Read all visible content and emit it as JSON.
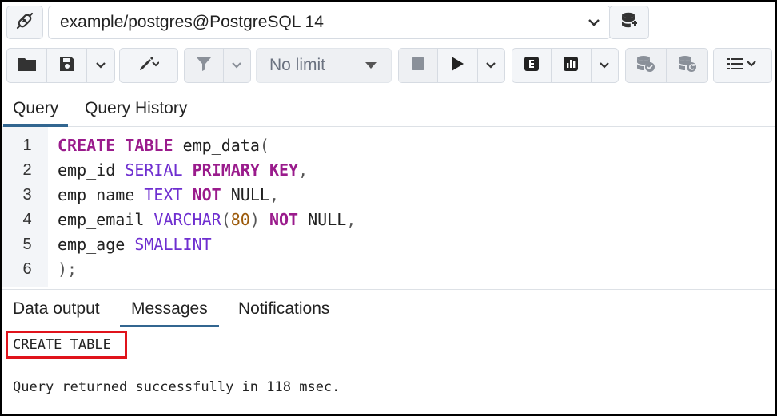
{
  "connection": {
    "label": "example/postgres@PostgreSQL 14"
  },
  "toolbar": {
    "limit_label": "No limit"
  },
  "tabs": [
    {
      "label": "Query"
    },
    {
      "label": "Query History"
    }
  ],
  "editor": {
    "lines": [
      {
        "num": "1"
      },
      {
        "num": "2"
      },
      {
        "num": "3"
      },
      {
        "num": "4"
      },
      {
        "num": "5"
      },
      {
        "num": "6"
      }
    ]
  },
  "code": {
    "l1": [
      "CREATE",
      "TABLE",
      "emp_data",
      "("
    ],
    "l2": [
      "emp_id",
      "SERIAL",
      "PRIMARY",
      "KEY",
      ","
    ],
    "l3": [
      "emp_name",
      "TEXT",
      "NOT",
      "NULL",
      ","
    ],
    "l4": [
      "emp_email",
      "VARCHAR",
      "(",
      "80",
      ")",
      "NOT",
      "NULL",
      ","
    ],
    "l5": [
      "emp_age",
      "SMALLINT"
    ],
    "l6": [
      ");"
    ]
  },
  "output_tabs": [
    {
      "label": "Data output"
    },
    {
      "label": "Messages"
    },
    {
      "label": "Notifications"
    }
  ],
  "messages": {
    "status": "CREATE TABLE",
    "result": "Query returned successfully in 118 msec."
  },
  "colors": {
    "accent": "#326690",
    "highlight": "#e0131b",
    "keyword": "#9a1b8c",
    "type": "#6f2fd0"
  }
}
